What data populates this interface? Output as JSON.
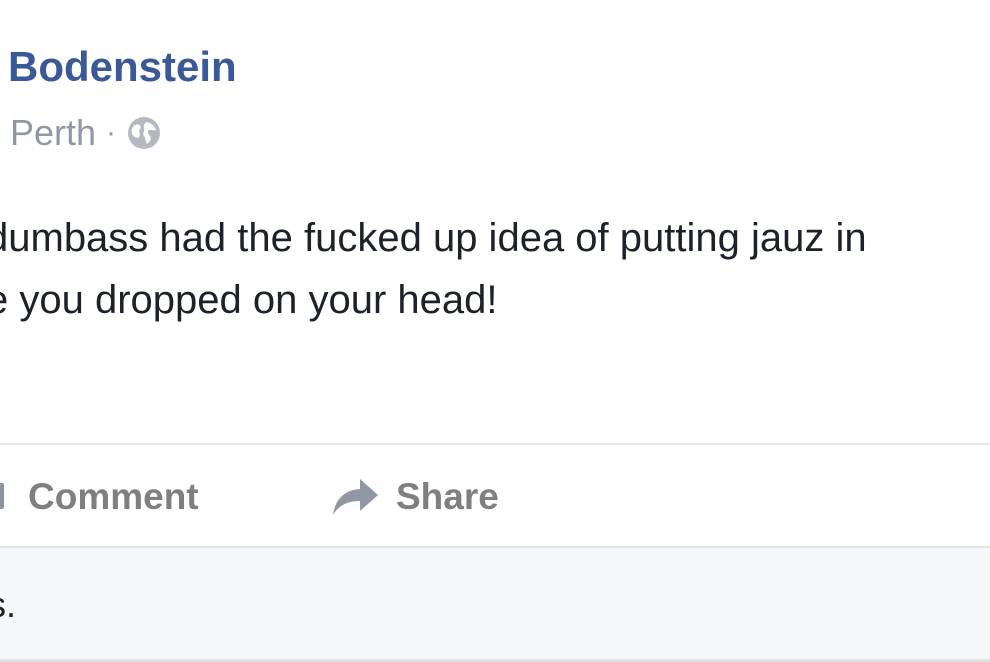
{
  "post": {
    "author": "Bodenstein",
    "location": "Perth",
    "separator": "·",
    "privacy_icon": "globe-icon",
    "text_lines": [
      "dumbass had the fucked up idea of putting jauz in",
      "e you dropped on your head!"
    ]
  },
  "actions": {
    "comment_label": "Comment",
    "comment_icon": "comment-icon",
    "share_label": "Share",
    "share_icon": "share-arrow-icon"
  },
  "footer": {
    "text": "is."
  },
  "colors": {
    "author_blue": "#3b5998",
    "meta_gray": "#9197a3",
    "action_gray": "#7f7f7f",
    "text": "#1d2129",
    "footer_bg": "#f6f7f9"
  }
}
